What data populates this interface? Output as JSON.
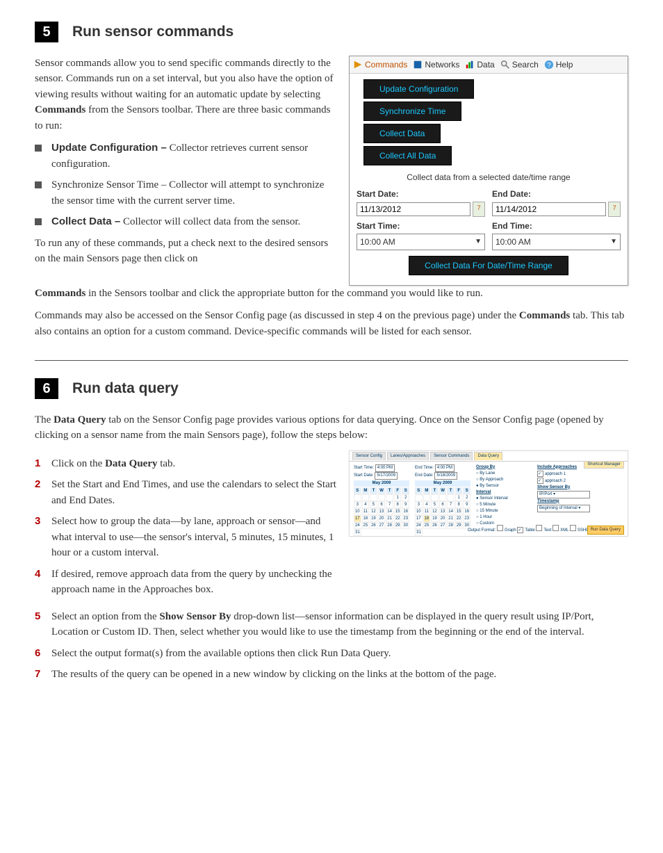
{
  "s5": {
    "num": "5",
    "title": "Run sensor commands",
    "p1a": "Sensor commands allow you to send specific commands directly to the sensor. Commands run on a set interval, but you also have the option of viewing results without waiting for an automatic update by selecting ",
    "p1b_bold": "Commands",
    "p1c": " from the Sensors toolbar. There are three basic commands to run:",
    "b1_bold": "Update Configuration –",
    "b1_rest": " Collector retrieves current sensor configuration.",
    "b2": "Synchronize Sensor Time – Collector will attempt to synchronize the sensor time with the current server time.",
    "b3_bold": "Collect Data –",
    "b3_rest": " Collector will collect data from the sensor.",
    "p2a": "To run any of these commands, put a check next to the desired sensors on the main Sensors page then click on ",
    "p2b_bold": "Commands",
    "p2c": " in the Sensors toolbar and click the appropriate button for the command you would like to run.",
    "p3a": "Commands may also be accessed on the Sensor Config page (as discussed in step 4 on the previous page) under the ",
    "p3b_bold": "Commands",
    "p3c": " tab. This tab also contains an option for a custom command. Device-specific commands will be listed for each sensor."
  },
  "menu": {
    "tabs": [
      "Commands",
      "Networks",
      "Data",
      "Search",
      "Help"
    ],
    "btn_update": "Update Configuration",
    "btn_sync": "Synchronize Time",
    "btn_collect": "Collect Data",
    "btn_collect_all": "Collect All Data",
    "caption": "Collect data from a selected date/time range",
    "start_date_label": "Start Date:",
    "end_date_label": "End Date:",
    "start_date": "11/13/2012",
    "end_date": "11/14/2012",
    "cal_glyph": "7",
    "start_time_label": "Start Time:",
    "end_time_label": "End Time:",
    "start_time": "10:00 AM",
    "end_time": "10:00 AM",
    "submit": "Collect Data For Date/Time Range"
  },
  "s6": {
    "num": "6",
    "title": "Run data query",
    "p1a": "The ",
    "p1b_bold": "Data Query",
    "p1c": " tab on the Sensor Config page provides various options for data querying. Once on the Sensor Config page (opened by clicking on a sensor name from the main Sensors page), follow the steps below:",
    "li1a": "Click on the ",
    "li1b_bold": "Data Query",
    "li1c": " tab.",
    "li2": "Set the Start and End Times, and use the calendars to select the Start and End Dates.",
    "li3": "Select how to group the data—by lane, approach or sensor—and what interval to use—the sensor's interval, 5 minutes, 15 minutes, 1 hour or a custom interval.",
    "li4": "If desired, remove approach data from the query by unchecking the approach name in the Approaches box.",
    "li5a": "Select an option from the ",
    "li5b_bold": "Show Sensor By",
    "li5c": " drop-down list—sensor information can be displayed in the query result using IP/Port, Location or Custom ID. Then, select whether you would like to use the timestamp from the beginning or the end of the interval.",
    "li6": "Select the output format(s) from the available options then click Run Data Query.",
    "li7": "The results of the query can be opened in a new window by clicking on the links at the bottom of the page.",
    "nums": [
      "1",
      "2",
      "3",
      "4",
      "5",
      "6",
      "7"
    ]
  },
  "thumb": {
    "tabs": [
      "Sensor Config",
      "Lanes/Approaches",
      "Sensor Commands",
      "Data Query"
    ],
    "shortcut": "Shortcut Manager",
    "start_time_label": "Start Time:",
    "start_time_val": "4:00 PM",
    "end_time_label": "End Time:",
    "end_time_val": "4:00 PM",
    "start_date_label": "Start Date:",
    "start_date_val": "5/17/2009",
    "end_date_label": "End Date:",
    "end_date_val": "5/18/2009",
    "month": "May 2009",
    "weekdays": [
      "S",
      "M",
      "T",
      "W",
      "T",
      "F",
      "S"
    ],
    "group_hd": "Group By",
    "group_opts": [
      "By Lane",
      "By Approach",
      "By Sensor"
    ],
    "interval_hd": "Interval",
    "interval_opts": [
      "Sensor Interval",
      "5 Minute",
      "15 Minute",
      "1 Hour",
      "Custom"
    ],
    "approaches_hd": "Include Approaches",
    "approaches": [
      "approach 1",
      "approach 2"
    ],
    "show_hd": "Show Sensor By",
    "show_val": "IP/Port",
    "ts_hd": "Timestamp",
    "ts_val": "Beginning of Interval",
    "of_label": "Output Format:",
    "of_opts": [
      "Graph",
      "Table",
      "Text",
      "XML",
      "SSHD"
    ],
    "run": "Run Data Query"
  }
}
